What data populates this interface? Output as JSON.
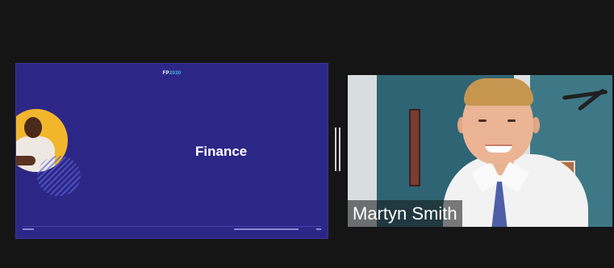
{
  "shared_content": {
    "slide": {
      "logo_prefix": "FP",
      "logo_accent": "2030",
      "title": "Finance"
    }
  },
  "participant": {
    "name": "Martyn Smith"
  },
  "colors": {
    "app_background": "#151515",
    "slide_background": "#2c2786",
    "slide_accent": "#46b9e6",
    "name_tag_text": "#ffffff"
  },
  "icons": {
    "divider": "resize-handle-icon"
  }
}
